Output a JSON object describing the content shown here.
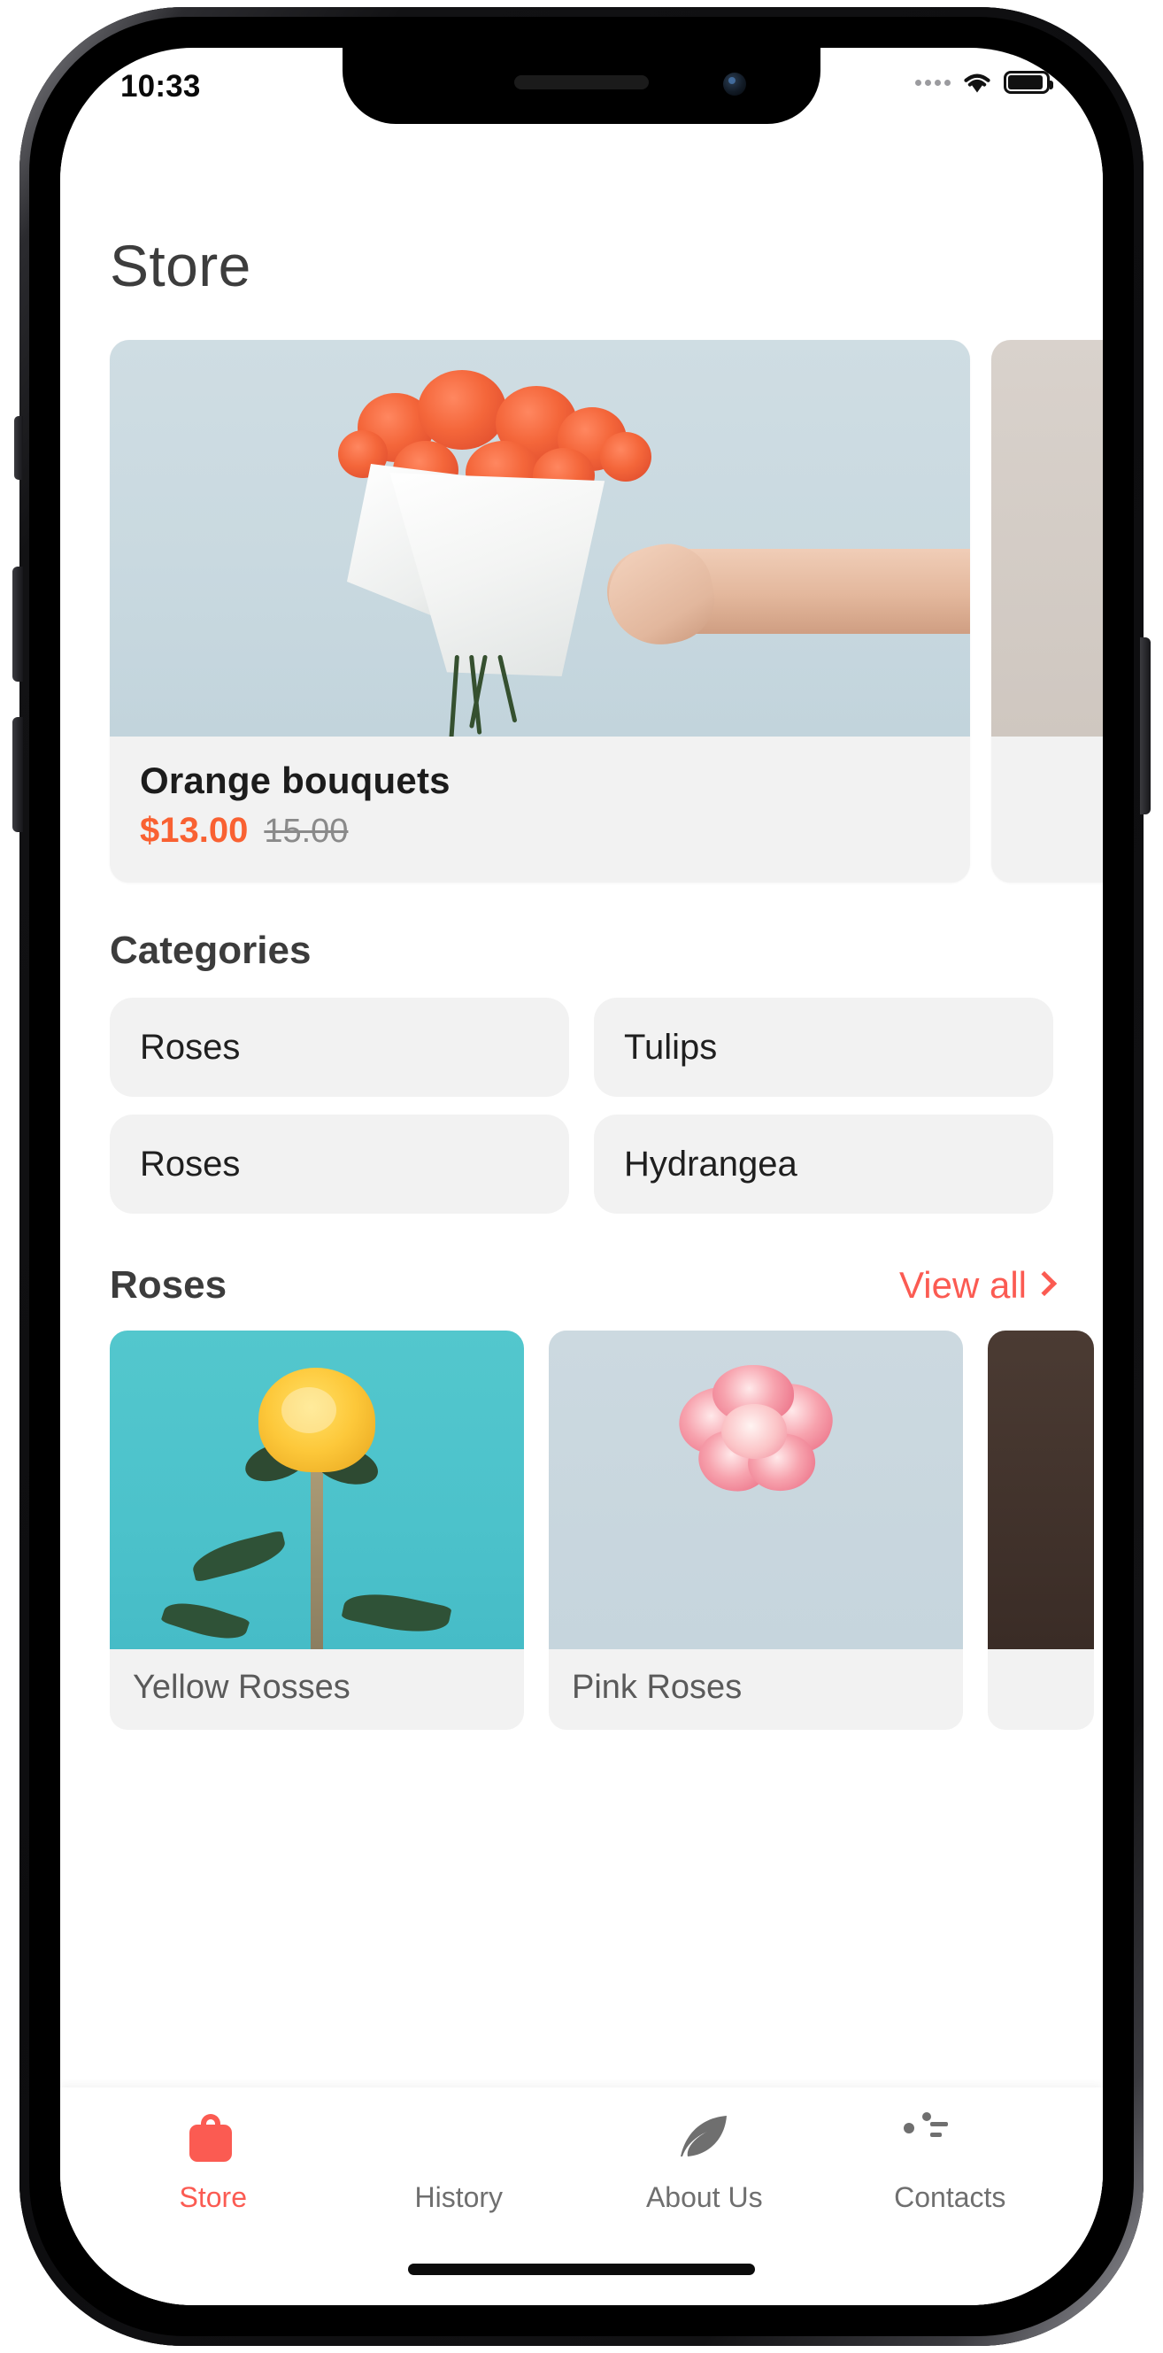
{
  "statusbar": {
    "time": "10:33",
    "signal_icon": "signal-dots-icon",
    "wifi_icon": "wifi-icon",
    "battery_icon": "battery-icon"
  },
  "header": {
    "title": "Store"
  },
  "hero": {
    "items": [
      {
        "name": "Orange bouquets",
        "price": "$13.00",
        "old_price": "15.00",
        "image_alt": "orange-bouquet-photo"
      },
      {
        "name": "",
        "price": "",
        "old_price": "",
        "image_alt": "next-bouquet-photo"
      }
    ]
  },
  "categories": {
    "title": "Categories",
    "items": [
      {
        "label": "Roses"
      },
      {
        "label": "Tulips"
      },
      {
        "label": "Roses"
      },
      {
        "label": "Hydrangea"
      }
    ]
  },
  "roses_section": {
    "title": "Roses",
    "view_all_label": "View all",
    "chevron_icon": "chevron-right-icon",
    "products": [
      {
        "name": "Yellow Rosses",
        "image_alt": "yellow-rose-photo"
      },
      {
        "name": "Pink Roses",
        "image_alt": "pink-rose-photo"
      },
      {
        "name": "",
        "image_alt": "next-rose-photo"
      }
    ]
  },
  "tabbar": {
    "items": [
      {
        "label": "Store",
        "icon": "shopping-bag-icon",
        "active": true
      },
      {
        "label": "History",
        "icon": "clock-icon",
        "active": false
      },
      {
        "label": "About Us",
        "icon": "leaf-icon",
        "active": false
      },
      {
        "label": "Contacts",
        "icon": "contact-card-icon",
        "active": false
      }
    ]
  },
  "colors": {
    "accent": "#fb5b52",
    "price": "#f96132",
    "muted": "#6f6f6f",
    "card_bg": "#f2f2f2"
  }
}
